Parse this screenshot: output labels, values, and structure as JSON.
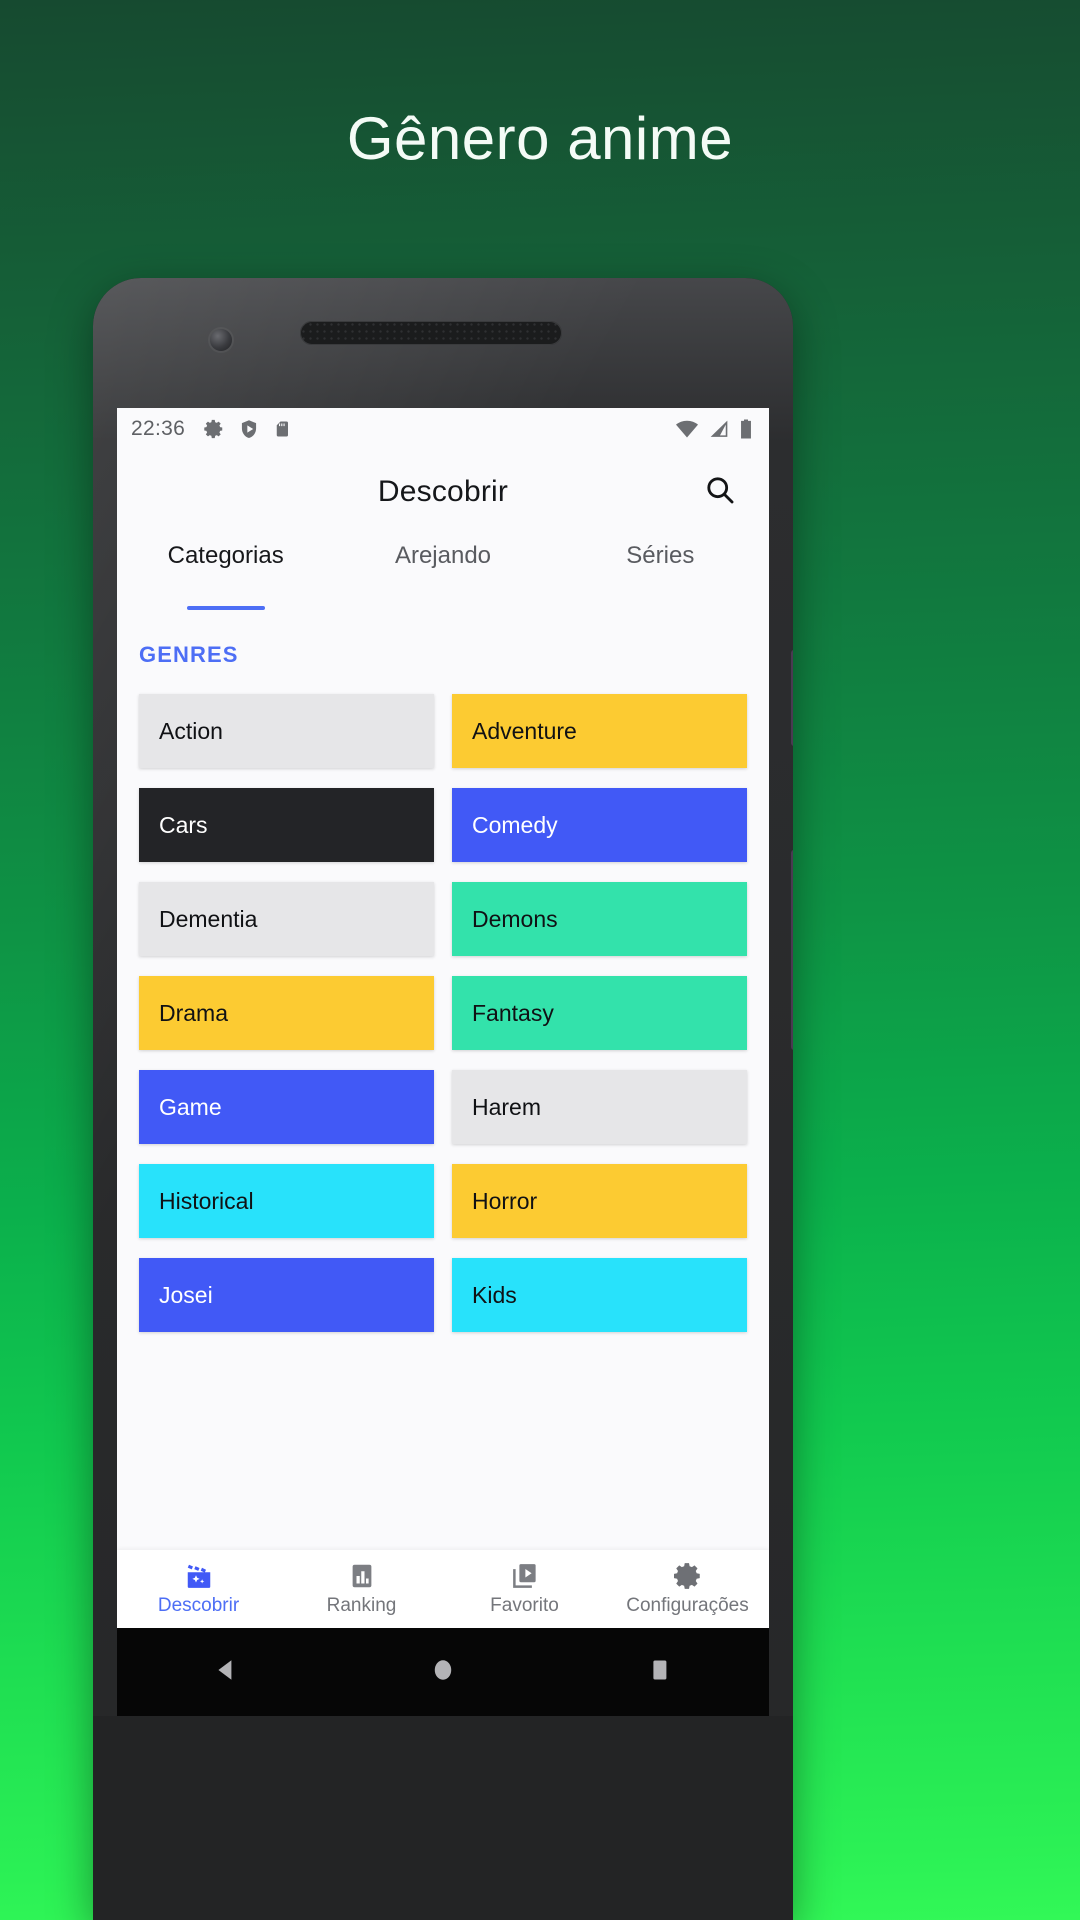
{
  "promo": {
    "headline": "Gênero anime",
    "background_top": "#164a30",
    "background_bottom": "#32f857"
  },
  "status_bar": {
    "time": "22:36",
    "left_icons": [
      "gear-icon",
      "shield-icon",
      "sd-card-icon"
    ],
    "right_icons": [
      "wifi-icon",
      "cell-signal-icon",
      "battery-icon"
    ]
  },
  "app_bar": {
    "title": "Descobrir",
    "search_icon": "search-icon"
  },
  "tabs": [
    {
      "label": "Categorias",
      "active": true
    },
    {
      "label": "Arejando",
      "active": false
    },
    {
      "label": "Séries",
      "active": false
    }
  ],
  "content": {
    "section_title": "GENRES",
    "accent_color": "#4d6ef5",
    "genres": [
      {
        "label": "Action",
        "bg": "#e6e6e8",
        "fg": "#101114"
      },
      {
        "label": "Adventure",
        "bg": "#fccb32",
        "fg": "#101114"
      },
      {
        "label": "Cars",
        "bg": "#232427",
        "fg": "#ffffff"
      },
      {
        "label": "Comedy",
        "bg": "#4159f6",
        "fg": "#ffffff"
      },
      {
        "label": "Dementia",
        "bg": "#e6e6e8",
        "fg": "#101114"
      },
      {
        "label": "Demons",
        "bg": "#33e2ab",
        "fg": "#101114"
      },
      {
        "label": "Drama",
        "bg": "#fccb32",
        "fg": "#101114"
      },
      {
        "label": "Fantasy",
        "bg": "#33e2ab",
        "fg": "#101114"
      },
      {
        "label": "Game",
        "bg": "#4159f6",
        "fg": "#ffffff"
      },
      {
        "label": "Harem",
        "bg": "#e6e6e8",
        "fg": "#101114"
      },
      {
        "label": "Historical",
        "bg": "#28e2fb",
        "fg": "#101114"
      },
      {
        "label": "Horror",
        "bg": "#fccb32",
        "fg": "#101114"
      },
      {
        "label": "Josei",
        "bg": "#4159f6",
        "fg": "#ffffff"
      },
      {
        "label": "Kids",
        "bg": "#28e2fb",
        "fg": "#101114"
      }
    ]
  },
  "bottom_nav": [
    {
      "label": "Descobrir",
      "icon": "discover-clapperboard-icon",
      "active": true
    },
    {
      "label": "Ranking",
      "icon": "bar-chart-icon",
      "active": false
    },
    {
      "label": "Favorito",
      "icon": "video-library-icon",
      "active": false
    },
    {
      "label": "Configurações",
      "icon": "gear-icon",
      "active": false
    }
  ],
  "android_nav": {
    "back": "back-triangle-icon",
    "home": "home-circle-icon",
    "recents": "recents-square-icon"
  }
}
